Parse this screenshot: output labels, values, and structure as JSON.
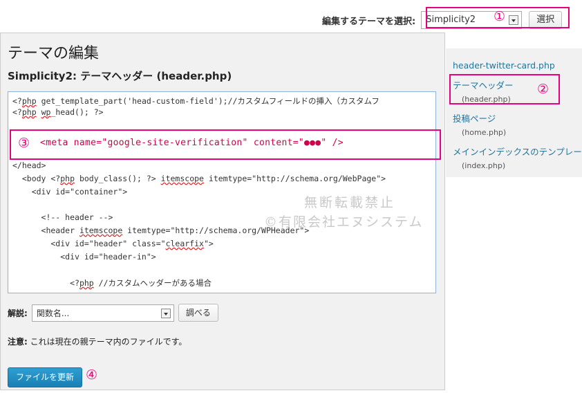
{
  "theme_selector": {
    "label": "編集するテーマを選択:",
    "selected": "Simplicity2",
    "select_button": "選択"
  },
  "annotations": {
    "n1": "①",
    "n2": "②",
    "n3": "③",
    "n4": "④"
  },
  "editor_page": {
    "title": "テーマの編集",
    "file_title_theme": "Simplicity2:",
    "file_title_file": "テーマヘッダー",
    "file_title_filename": "(header.php)"
  },
  "code": {
    "l1_tag": "<?",
    "l1_php": "php",
    "l1_rest": " get_template_part('head-custom-field');//カスタムフィールドの挿入（カスタムフ",
    "l2_tag": "<?",
    "l2_php": "php",
    "l2_sp": " ",
    "l2_fn": "wp",
    "l2_rest": "_head(); ?>",
    "meta": "<meta name=\"google-site-verification\" content=\"●●●\" />",
    "l4": "</head>",
    "l5_a": "  <body <?",
    "l5_php": "php",
    "l5_b": " body_class(); ?> ",
    "l5_attr": "itemscope",
    "l5_c": " itemtype=\"http://schema.org/WebPage\">",
    "l6": "    <div id=\"container\">",
    "l7": "      <!-- header -->",
    "l8_a": "      <header ",
    "l8_attr": "itemscope",
    "l8_b": " itemtype=\"http://schema.org/WPHeader\">",
    "l9_a": "        <div id=\"header\" class=\"",
    "l9_cls": "clearfix",
    "l9_b": "\">",
    "l10": "          <div id=\"header-in\">",
    "l11_a": "            <?",
    "l11_php": "php",
    "l11_b": " //カスタムヘッダーがある場合"
  },
  "watermark": {
    "line1": "無断転載禁止",
    "line2": "©有限会社エヌシステム"
  },
  "explain": {
    "label": "解説:",
    "placeholder": "関数名...",
    "lookup_button": "調べる"
  },
  "notice": {
    "bold": "注意:",
    "text": " これは現在の親テーマ内のファイルです。"
  },
  "update_button": "ファイルを更新",
  "sidebar": {
    "items": [
      {
        "label": "header-twitter-card.php",
        "sub": ""
      },
      {
        "label": "テーマヘッダー",
        "sub": "(header.php)"
      },
      {
        "label": "投稿ページ",
        "sub": "(home.php)"
      },
      {
        "label": "メインインデックスのテンプレート",
        "sub": "(index.php)"
      }
    ]
  },
  "colors": {
    "annotation": "#e6007e",
    "link": "#21759b",
    "primary_button": "#2184ba"
  }
}
